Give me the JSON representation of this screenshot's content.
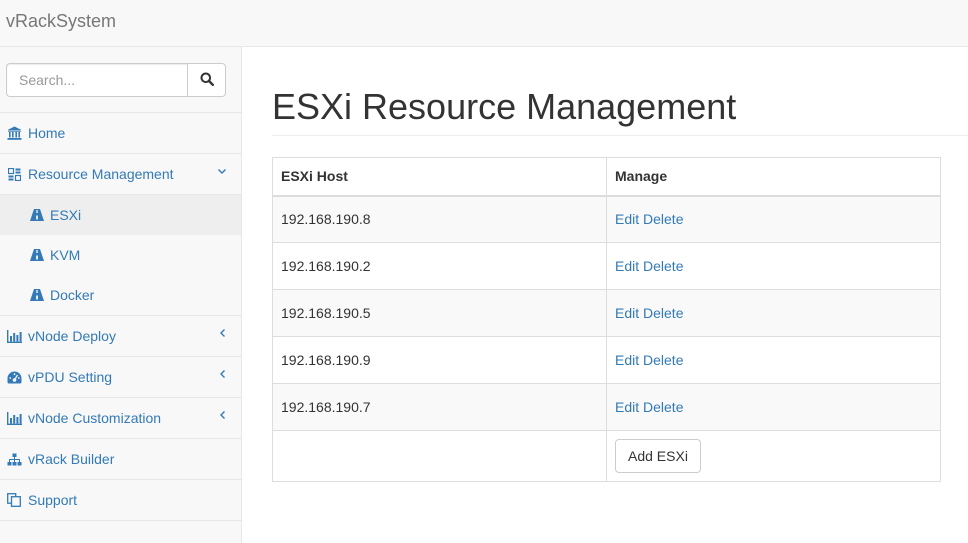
{
  "app": {
    "brand": "vRackSystem"
  },
  "search": {
    "placeholder": "Search..."
  },
  "sidebar": {
    "items": [
      {
        "label": "Home",
        "icon": "bank-icon"
      },
      {
        "label": "Resource Management",
        "icon": "grid-icon",
        "expanded": true,
        "children": [
          {
            "label": "ESXi",
            "icon": "road-icon",
            "active": true
          },
          {
            "label": "KVM",
            "icon": "road-icon"
          },
          {
            "label": "Docker",
            "icon": "road-icon"
          }
        ]
      },
      {
        "label": "vNode Deploy",
        "icon": "bar-chart-icon"
      },
      {
        "label": "vPDU Setting",
        "icon": "dashboard-icon"
      },
      {
        "label": "vNode Customization",
        "icon": "bar-chart-icon"
      },
      {
        "label": "vRack Builder",
        "icon": "sitemap-icon"
      },
      {
        "label": "Support",
        "icon": "copy-icon"
      }
    ]
  },
  "main": {
    "title": "ESXi Resource Management",
    "table": {
      "headers": [
        "ESXi Host",
        "Manage"
      ],
      "rows": [
        {
          "host": "192.168.190.8",
          "edit": "Edit",
          "delete": "Delete"
        },
        {
          "host": "192.168.190.2",
          "edit": "Edit",
          "delete": "Delete"
        },
        {
          "host": "192.168.190.5",
          "edit": "Edit",
          "delete": "Delete"
        },
        {
          "host": "192.168.190.9",
          "edit": "Edit",
          "delete": "Delete"
        },
        {
          "host": "192.168.190.7",
          "edit": "Edit",
          "delete": "Delete"
        }
      ],
      "add_button": "Add ESXi"
    }
  },
  "colors": {
    "link": "#337ab7",
    "navbar_bg": "#f8f8f8",
    "border": "#e7e7e7",
    "active_bg": "#eeeeee"
  }
}
